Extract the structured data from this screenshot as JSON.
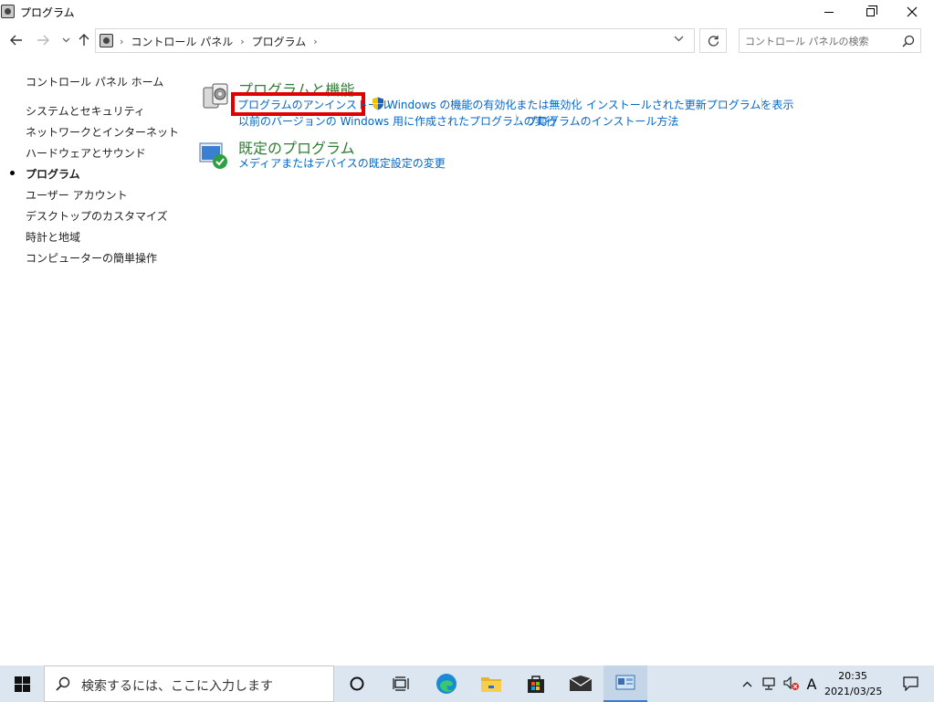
{
  "window": {
    "title": "プログラム"
  },
  "address": {
    "crumbs": [
      "コントロール パネル",
      "プログラム"
    ],
    "search_placeholder": "コントロール パネルの検索"
  },
  "sidebar": {
    "home": "コントロール パネル ホーム",
    "items": [
      {
        "label": "システムとセキュリティ"
      },
      {
        "label": "ネットワークとインターネット"
      },
      {
        "label": "ハードウェアとサウンド"
      },
      {
        "label": "プログラム",
        "active": true
      },
      {
        "label": "ユーザー アカウント"
      },
      {
        "label": "デスクトップのカスタマイズ"
      },
      {
        "label": "時計と地域"
      },
      {
        "label": "コンピューターの簡単操作"
      }
    ]
  },
  "main": {
    "programs_features": {
      "title": "プログラムと機能",
      "links": [
        "プログラムのアンインストール",
        "Windows の機能の有効化または無効化",
        "インストールされた更新プログラムを表示",
        "以前のバージョンの Windows 用に作成されたプログラムの実行",
        "プログラムのインストール方法"
      ]
    },
    "default_programs": {
      "title": "既定のプログラム",
      "links": [
        "メディアまたはデバイスの既定設定の変更"
      ]
    }
  },
  "taskbar": {
    "search_placeholder": "検索するには、ここに入力します",
    "ime": "A",
    "time": "20:35",
    "date": "2021/03/25"
  },
  "colors": {
    "link": "#0066cc",
    "category_title": "#2e7d32",
    "highlight": "#e00000",
    "taskbar": "#dce6f0"
  }
}
